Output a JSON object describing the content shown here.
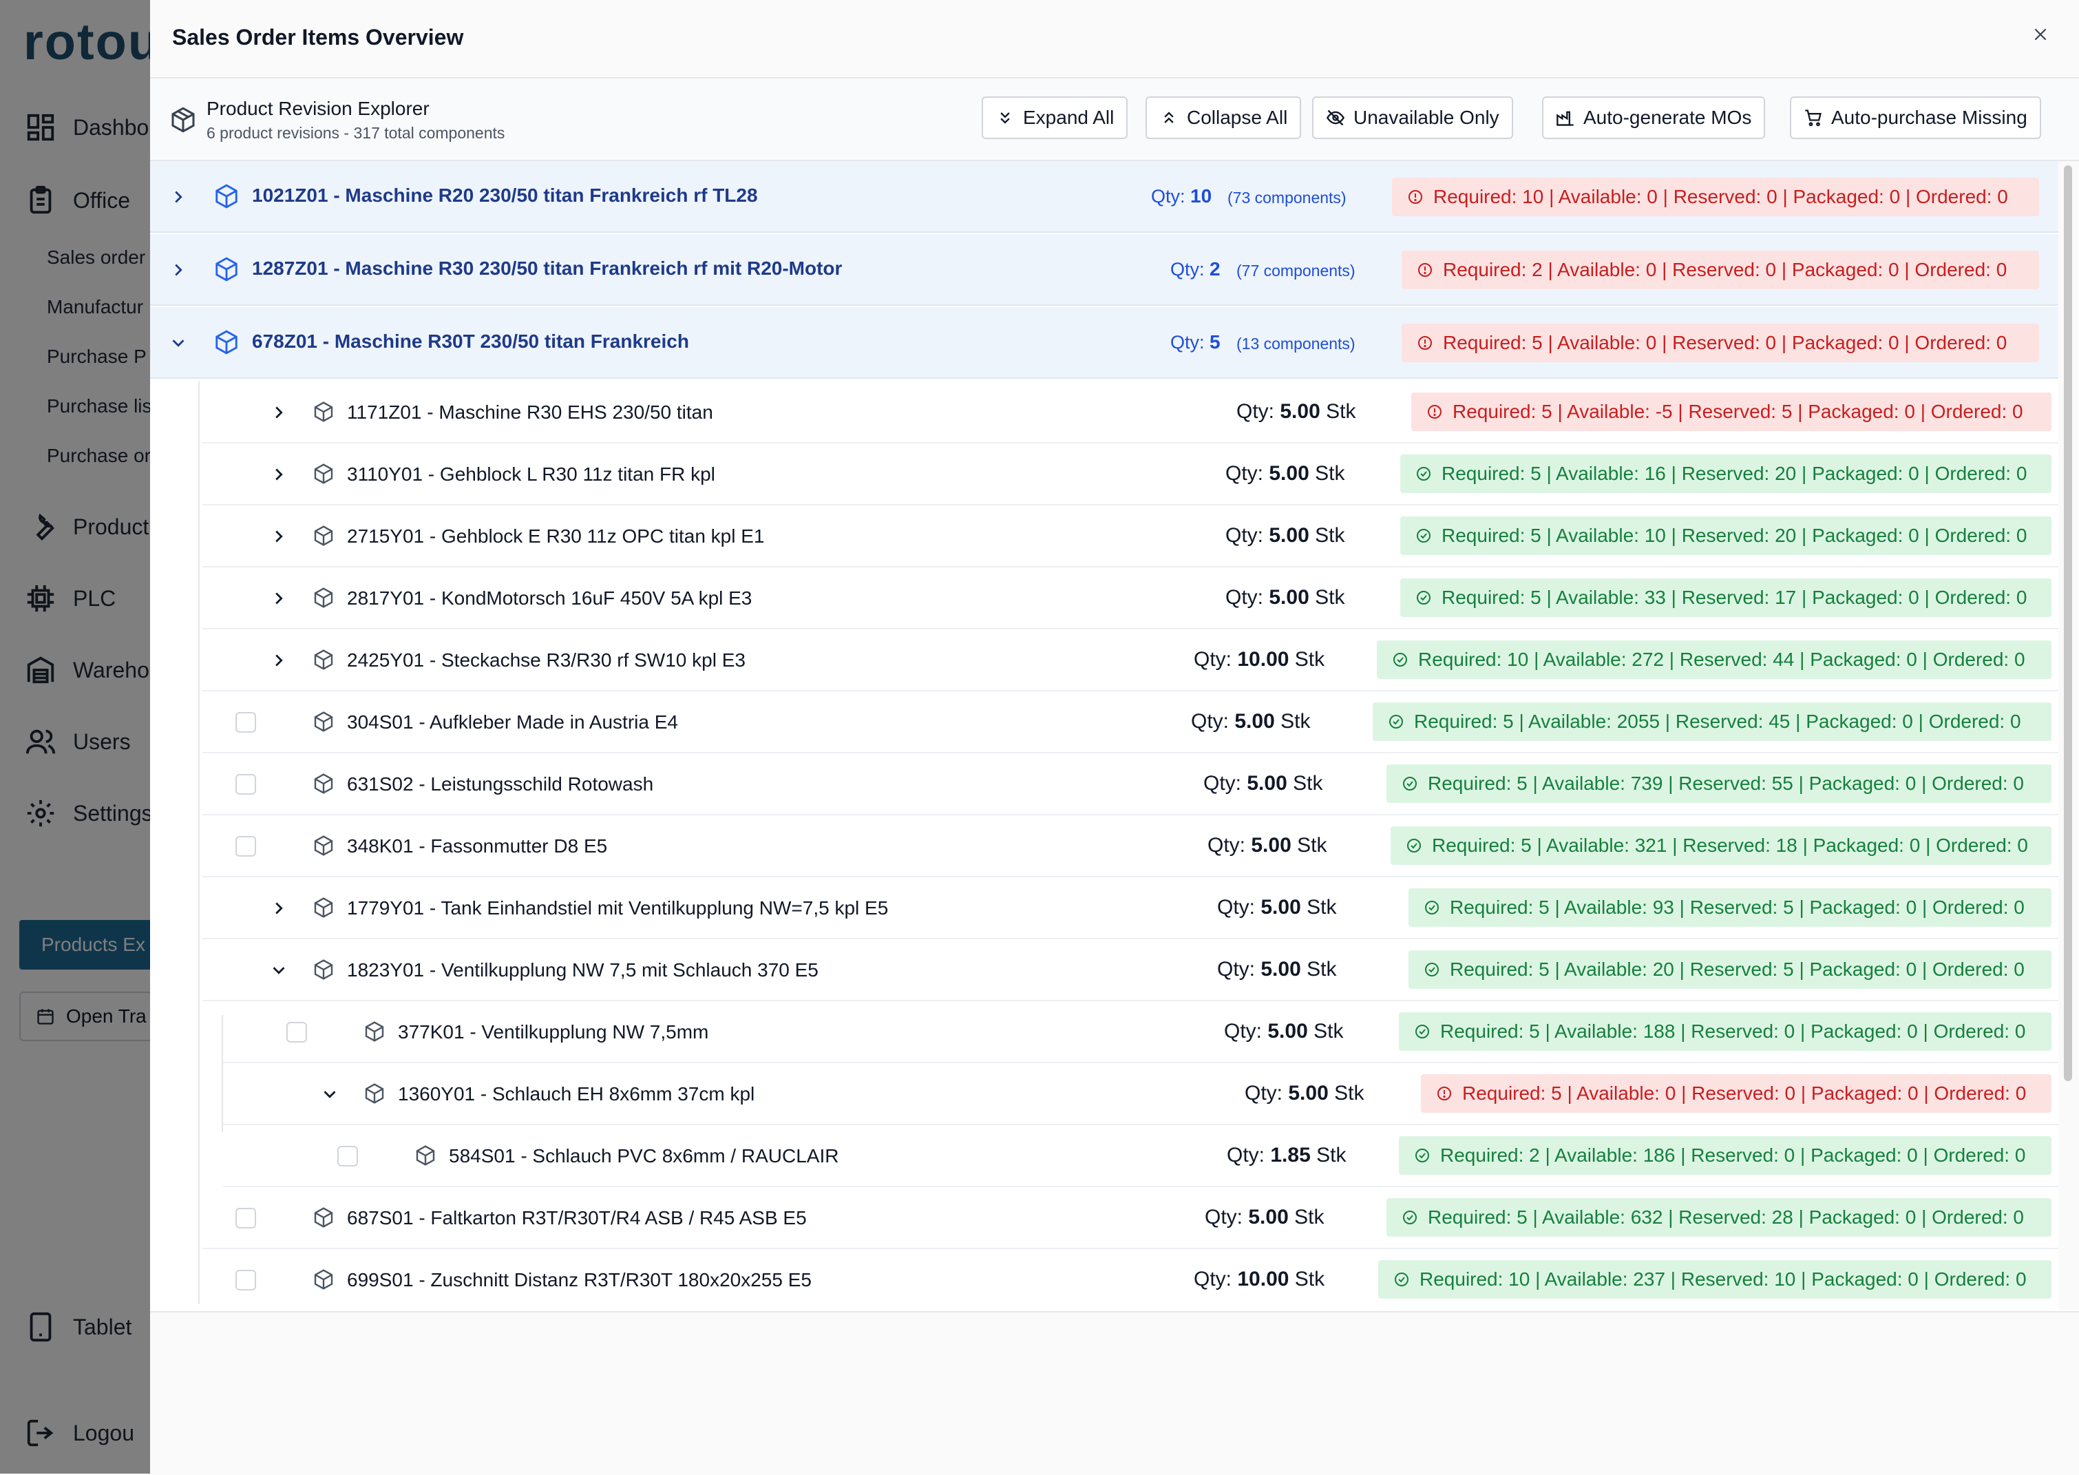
{
  "bg": {
    "logo": "rotou",
    "nav": [
      {
        "label": "Dashbo",
        "icon": "dashboard-icon"
      },
      {
        "label": "Office",
        "icon": "clipboard-icon"
      },
      {
        "label": "Product",
        "icon": "wrench-icon"
      },
      {
        "label": "PLC",
        "icon": "chip-icon"
      },
      {
        "label": "Wareho",
        "icon": "warehouse-icon"
      },
      {
        "label": "Users",
        "icon": "users-icon"
      },
      {
        "label": "Settings",
        "icon": "gear-icon"
      },
      {
        "label": "Tablet",
        "icon": "tablet-icon"
      },
      {
        "label": "Logou",
        "icon": "logout-icon"
      }
    ],
    "sub": [
      "Sales order",
      "Manufactur",
      "Purchase P",
      "Purchase lis",
      "Purchase or"
    ],
    "active": "Products Ex",
    "open": "Open Tra"
  },
  "modal": {
    "title": "Sales Order Items Overview",
    "close": "×"
  },
  "explorer": {
    "title": "Product Revision Explorer",
    "subtitle": "6 product revisions - 317 total components",
    "buttons": {
      "expand": "Expand All",
      "collapse": "Collapse All",
      "unavailable": "Unavailable Only",
      "automo": "Auto-generate MOs",
      "autopurchase": "Auto-purchase Missing"
    }
  },
  "top": [
    {
      "title": "1021Z01 - Maschine R20 230/50 titan Frankreich rf TL28",
      "qty_label": "Qty:",
      "qty": "10",
      "components": "(73 components)",
      "status": "Required: 10 | Available: 0 | Reserved: 0 | Packaged: 0 | Ordered: 0",
      "state": "red"
    },
    {
      "title": "1287Z01 - Maschine R30 230/50 titan Frankreich rf mit R20-Motor",
      "qty_label": "Qty:",
      "qty": "2",
      "components": "(77 components)",
      "status": "Required: 2 | Available: 0 | Reserved: 0 | Packaged: 0 | Ordered: 0",
      "state": "red"
    },
    {
      "title": "678Z01 - Maschine R30T 230/50 titan Frankreich",
      "qty_label": "Qty:",
      "qty": "5",
      "components": "(13 components)",
      "status": "Required: 5 | Available: 0 | Reserved: 0 | Packaged: 0 | Ordered: 0",
      "state": "red"
    }
  ],
  "children": [
    {
      "title": "1171Z01 - Maschine R30 EHS 230/50 titan",
      "qty_label": "Qty:",
      "qty": "5.00",
      "unit": "Stk",
      "status": "Required: 5 | Available: -5 | Reserved: 5 | Packaged: 0 | Ordered: 0",
      "state": "red"
    },
    {
      "title": "3110Y01 - Gehblock L R30 11z titan FR kpl",
      "qty_label": "Qty:",
      "qty": "5.00",
      "unit": "Stk",
      "status": "Required: 5 | Available: 16 | Reserved: 20 | Packaged: 0 | Ordered: 0",
      "state": "green"
    },
    {
      "title": "2715Y01 - Gehblock E R30 11z OPC titan kpl E1",
      "qty_label": "Qty:",
      "qty": "5.00",
      "unit": "Stk",
      "status": "Required: 5 | Available: 10 | Reserved: 20 | Packaged: 0 | Ordered: 0",
      "state": "green"
    },
    {
      "title": "2817Y01 - KondMotorsch 16uF 450V 5A kpl E3",
      "qty_label": "Qty:",
      "qty": "5.00",
      "unit": "Stk",
      "status": "Required: 5 | Available: 33 | Reserved: 17 | Packaged: 0 | Ordered: 0",
      "state": "green"
    },
    {
      "title": "2425Y01 - Steckachse R3/R30 rf SW10 kpl E3",
      "qty_label": "Qty:",
      "qty": "10.00",
      "unit": "Stk",
      "status": "Required: 10 | Available: 272 | Reserved: 44 | Packaged: 0 | Ordered: 0",
      "state": "green"
    },
    {
      "title": "304S01 - Aufkleber Made in Austria E4",
      "qty_label": "Qty:",
      "qty": "5.00",
      "unit": "Stk",
      "status": "Required: 5 | Available: 2055 | Reserved: 45 | Packaged: 0 | Ordered: 0",
      "state": "green"
    },
    {
      "title": "631S02 - Leistungsschild Rotowash",
      "qty_label": "Qty:",
      "qty": "5.00",
      "unit": "Stk",
      "status": "Required: 5 | Available: 739 | Reserved: 55 | Packaged: 0 | Ordered: 0",
      "state": "green"
    },
    {
      "title": "348K01 - Fassonmutter D8 E5",
      "qty_label": "Qty:",
      "qty": "5.00",
      "unit": "Stk",
      "status": "Required: 5 | Available: 321 | Reserved: 18 | Packaged: 0 | Ordered: 0",
      "state": "green"
    },
    {
      "title": "1779Y01 - Tank Einhandstiel mit Ventilkupplung NW=7,5 kpl E5",
      "qty_label": "Qty:",
      "qty": "5.00",
      "unit": "Stk",
      "status": "Required: 5 | Available: 93 | Reserved: 5 | Packaged: 0 | Ordered: 0",
      "state": "green"
    },
    {
      "title": "1823Y01 - Ventilkupplung NW 7,5 mit Schlauch 370 E5",
      "qty_label": "Qty:",
      "qty": "5.00",
      "unit": "Stk",
      "status": "Required: 5 | Available: 20 | Reserved: 5 | Packaged: 0 | Ordered: 0",
      "state": "green"
    },
    {
      "title": "377K01 - Ventilkupplung NW 7,5mm",
      "qty_label": "Qty:",
      "qty": "5.00",
      "unit": "Stk",
      "status": "Required: 5 | Available: 188 | Reserved: 0 | Packaged: 0 | Ordered: 0",
      "state": "green"
    },
    {
      "title": "1360Y01 - Schlauch EH 8x6mm 37cm kpl",
      "qty_label": "Qty:",
      "qty": "5.00",
      "unit": "Stk",
      "status": "Required: 5 | Available: 0 | Reserved: 0 | Packaged: 0 | Ordered: 0",
      "state": "red"
    },
    {
      "title": "584S01 - Schlauch PVC 8x6mm / RAUCLAIR",
      "qty_label": "Qty:",
      "qty": "1.85",
      "unit": "Stk",
      "status": "Required: 2 | Available: 186 | Reserved: 0 | Packaged: 0 | Ordered: 0",
      "state": "green"
    },
    {
      "title": "687S01 - Faltkarton R3T/R30T/R4 ASB / R45 ASB E5",
      "qty_label": "Qty:",
      "qty": "5.00",
      "unit": "Stk",
      "status": "Required: 5 | Available: 632 | Reserved: 28 | Packaged: 0 | Ordered: 0",
      "state": "green"
    },
    {
      "title": "699S01 - Zuschnitt Distanz R3T/R30T 180x20x255 E5",
      "qty_label": "Qty:",
      "qty": "10.00",
      "unit": "Stk",
      "status": "Required: 10 | Available: 237 | Reserved: 10 | Packaged: 0 | Ordered: 0",
      "state": "green"
    }
  ],
  "colors": {
    "accent": "#1e3a8a",
    "red_bg": "#fde2e2",
    "red_text": "#c81e1e",
    "green_bg": "#dcf5e3",
    "green_text": "#15803d"
  }
}
